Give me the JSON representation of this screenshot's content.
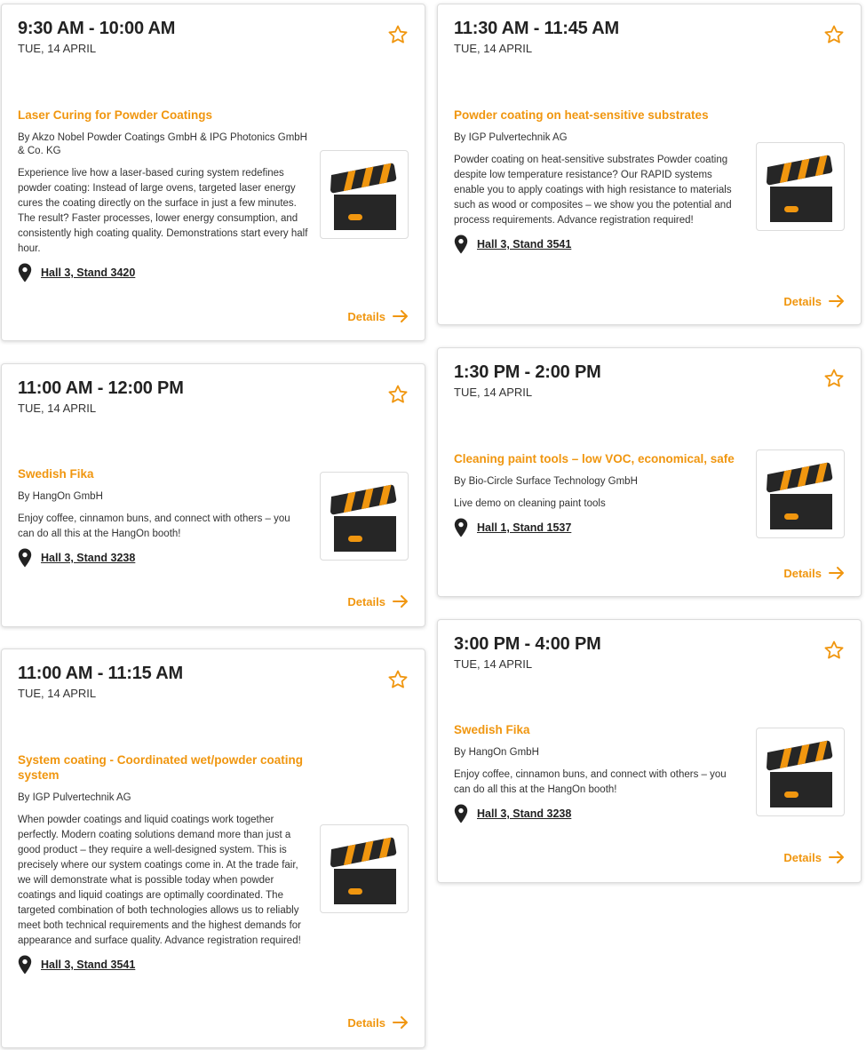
{
  "accent_color": "#f0960f",
  "icons": {
    "favorite": "star-outline-icon",
    "location": "map-pin-icon",
    "thumbnail": "clapperboard-icon",
    "details": "arrow-right-icon"
  },
  "sessions": [
    {
      "time": "9:30 AM - 10:00 AM",
      "date": "TUE, 14 APRIL",
      "title": "Laser Curing for Powder Coatings",
      "by": "By Akzo Nobel Powder Coatings GmbH & IPG Photonics GmbH & Co. KG",
      "description": "Experience live how a laser-based curing system redefines powder coating: Instead of large ovens, targeted laser energy cures the coating directly on the surface in just a few minutes. The result? Faster processes, lower energy consumption, and consistently high coating quality. Demonstrations start every half hour.",
      "location": "Hall 3, Stand 3420",
      "details": "Details"
    },
    {
      "time": "11:00 AM - 12:00 PM",
      "date": "TUE, 14 APRIL",
      "title": "Swedish Fika",
      "by": "By HangOn GmbH",
      "description": "Enjoy coffee, cinnamon buns, and connect with others – you can do all this at the HangOn booth!",
      "location": "Hall 3, Stand 3238",
      "details": "Details"
    },
    {
      "time": "11:00 AM - 11:15 AM",
      "date": "TUE, 14 APRIL",
      "title": "System coating - Coordinated wet/powder coating system",
      "by": "By IGP Pulvertechnik AG",
      "description": "When powder coatings and liquid coatings work together perfectly. Modern coating solutions demand more than just a good product – they require a well-designed system. This is precisely where our system coatings come in. At the trade fair, we will demonstrate what is possible today when powder coatings and liquid coatings are optimally coordinated. The targeted combination of both technologies allows us to reliably meet both technical requirements and the highest demands for appearance and surface quality. Advance registration required!",
      "location": "Hall 3, Stand 3541",
      "details": "Details"
    },
    {
      "time": "11:30 AM - 11:45 AM",
      "date": "TUE, 14 APRIL",
      "title": "Powder coating on heat-sensitive substrates",
      "by": "By IGP Pulvertechnik AG",
      "description": "Powder coating on heat-sensitive substrates Powder coating despite low temperature resistance? Our RAPID systems enable you to apply coatings with high resistance to materials such as wood or composites – we show you the potential and process requirements. Advance registration required!",
      "location": "Hall 3, Stand 3541",
      "details": "Details"
    },
    {
      "time": "1:30 PM - 2:00 PM",
      "date": "TUE, 14 APRIL",
      "title": "Cleaning paint tools – low VOC, economical, safe",
      "by": "By Bio-Circle Surface Technology GmbH",
      "description": "Live demo on cleaning paint tools",
      "location": "Hall 1, Stand 1537",
      "details": "Details"
    },
    {
      "time": "3:00 PM - 4:00 PM",
      "date": "TUE, 14 APRIL",
      "title": "Swedish Fika",
      "by": "By HangOn GmbH",
      "description": "Enjoy coffee, cinnamon buns, and connect with others – you can do all this at the HangOn booth!",
      "location": "Hall 3, Stand 3238",
      "details": "Details"
    }
  ]
}
